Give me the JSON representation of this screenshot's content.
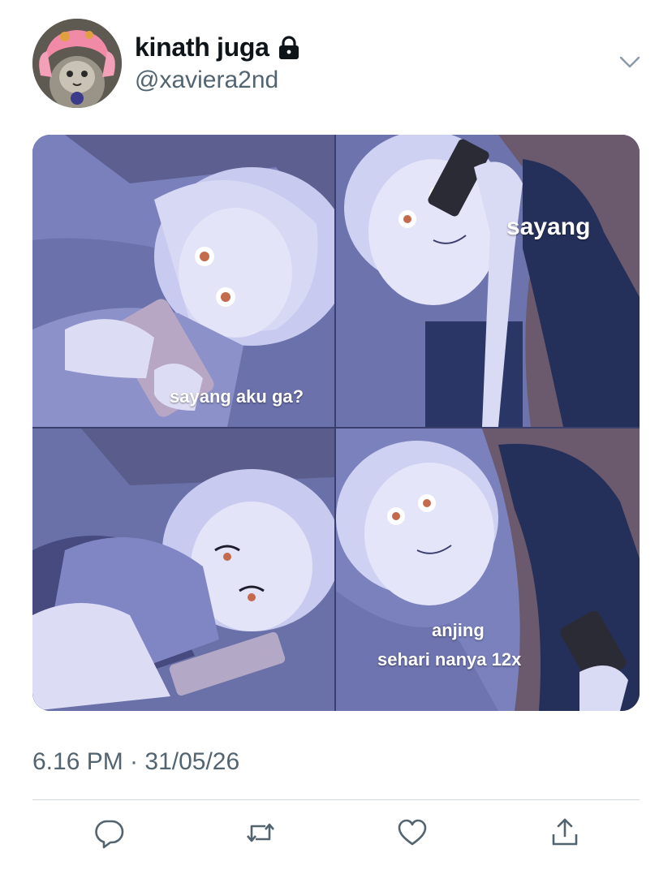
{
  "user": {
    "display_name": "kinath juga",
    "handle": "@xaviera2nd"
  },
  "icons": {
    "protected": "lock-icon",
    "more": "chevron-down-icon",
    "reply": "reply-icon",
    "retweet": "retweet-icon",
    "like": "heart-icon",
    "share": "share-icon"
  },
  "meme": {
    "panel_1_caption": "sayang aku ga?",
    "panel_2_caption": "sayang",
    "panel_4_caption_line1": "anjing",
    "panel_4_caption_line2": "sehari nanya 12x"
  },
  "tweet": {
    "timestamp": "6.16 PM · 31/05/26"
  },
  "colors": {
    "text_primary": "#0f1419",
    "text_secondary": "#536471",
    "divider": "#cfd9de",
    "meme_tint": "#7b82bd"
  }
}
